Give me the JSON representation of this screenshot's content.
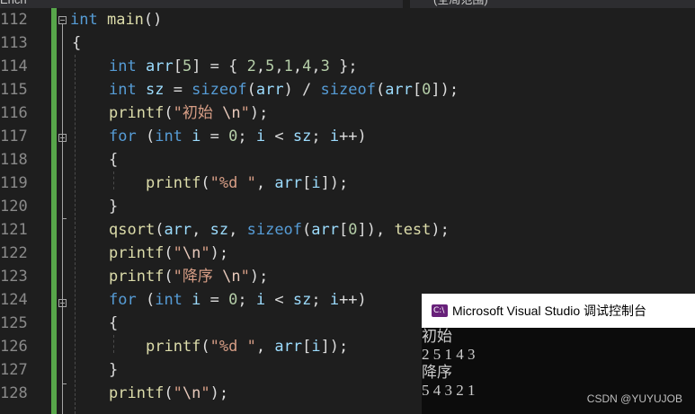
{
  "tabs": {
    "left": "Ench",
    "right": "(全局范围)"
  },
  "line_numbers": [
    "112",
    "113",
    "114",
    "115",
    "116",
    "117",
    "118",
    "119",
    "120",
    "121",
    "122",
    "123",
    "124",
    "125",
    "126",
    "127",
    "128"
  ],
  "code": {
    "l112": {
      "t1": "int",
      "t2": " ",
      "t3": "main",
      "t4": "()"
    },
    "l113": {
      "t1": "{"
    },
    "l114": {
      "t1": "int",
      "t2": " ",
      "t3": "arr",
      "t4": "[",
      "t5": "5",
      "t6": "] = { ",
      "t7": "2",
      "t8": ",",
      "t9": "5",
      "t10": ",",
      "t11": "1",
      "t12": ",",
      "t13": "4",
      "t14": ",",
      "t15": "3",
      "t16": " };"
    },
    "l115": {
      "t1": "int",
      "t2": " ",
      "t3": "sz",
      "t4": " = ",
      "t5": "sizeof",
      "t6": "(",
      "t7": "arr",
      "t8": ") / ",
      "t9": "sizeof",
      "t10": "(",
      "t11": "arr",
      "t12": "[",
      "t13": "0",
      "t14": "]);"
    },
    "l116": {
      "t1": "printf",
      "t2": "(",
      "t3": "\"初始 ",
      "t4": "\\n",
      "t5": "\"",
      "t6": ");"
    },
    "l117": {
      "t1": "for",
      "t2": " (",
      "t3": "int",
      "t4": " ",
      "t5": "i",
      "t6": " = ",
      "t7": "0",
      "t8": "; ",
      "t9": "i",
      "t10": " < ",
      "t11": "sz",
      "t12": "; ",
      "t13": "i",
      "t14": "++)"
    },
    "l118": {
      "t1": "{"
    },
    "l119": {
      "t1": "printf",
      "t2": "(",
      "t3": "\"%d \"",
      "t4": ", ",
      "t5": "arr",
      "t6": "[",
      "t7": "i",
      "t8": "]);"
    },
    "l120": {
      "t1": "}"
    },
    "l121": {
      "t1": "qsort",
      "t2": "(",
      "t3": "arr",
      "t4": ", ",
      "t5": "sz",
      "t6": ", ",
      "t7": "sizeof",
      "t8": "(",
      "t9": "arr",
      "t10": "[",
      "t11": "0",
      "t12": "]), ",
      "t13": "test",
      "t14": ");"
    },
    "l122": {
      "t1": "printf",
      "t2": "(",
      "t3": "\"",
      "t4": "\\n",
      "t5": "\"",
      "t6": ");"
    },
    "l123": {
      "t1": "printf",
      "t2": "(",
      "t3": "\"降序 ",
      "t4": "\\n",
      "t5": "\"",
      "t6": ");"
    },
    "l124": {
      "t1": "for",
      "t2": " (",
      "t3": "int",
      "t4": " ",
      "t5": "i",
      "t6": " = ",
      "t7": "0",
      "t8": "; ",
      "t9": "i",
      "t10": " < ",
      "t11": "sz",
      "t12": "; ",
      "t13": "i",
      "t14": "++)"
    },
    "l125": {
      "t1": "{"
    },
    "l126": {
      "t1": "printf",
      "t2": "(",
      "t3": "\"%d \"",
      "t4": ", ",
      "t5": "arr",
      "t6": "[",
      "t7": "i",
      "t8": "]);"
    },
    "l127": {
      "t1": "}"
    },
    "l128": {
      "t1": "printf",
      "t2": "(",
      "t3": "\"",
      "t4": "\\n",
      "t5": "\"",
      "t6": ");"
    }
  },
  "console": {
    "icon_text": "C:\\",
    "title": "Microsoft Visual Studio 调试控制台",
    "output": [
      "初始",
      "2 5 1 4 3",
      "降序",
      "5 4 3 2 1"
    ]
  },
  "watermark": "CSDN @YUYUJOB",
  "colors": {
    "background": "#1e1e1e",
    "line_number": "#2b91af",
    "keyword": "#569cd6",
    "function": "#dcdcaa",
    "variable": "#9cdcfe",
    "number": "#b5cea8",
    "string": "#d69d85",
    "change_bar": "#57a64a",
    "console_bg": "#0c0c0c"
  }
}
